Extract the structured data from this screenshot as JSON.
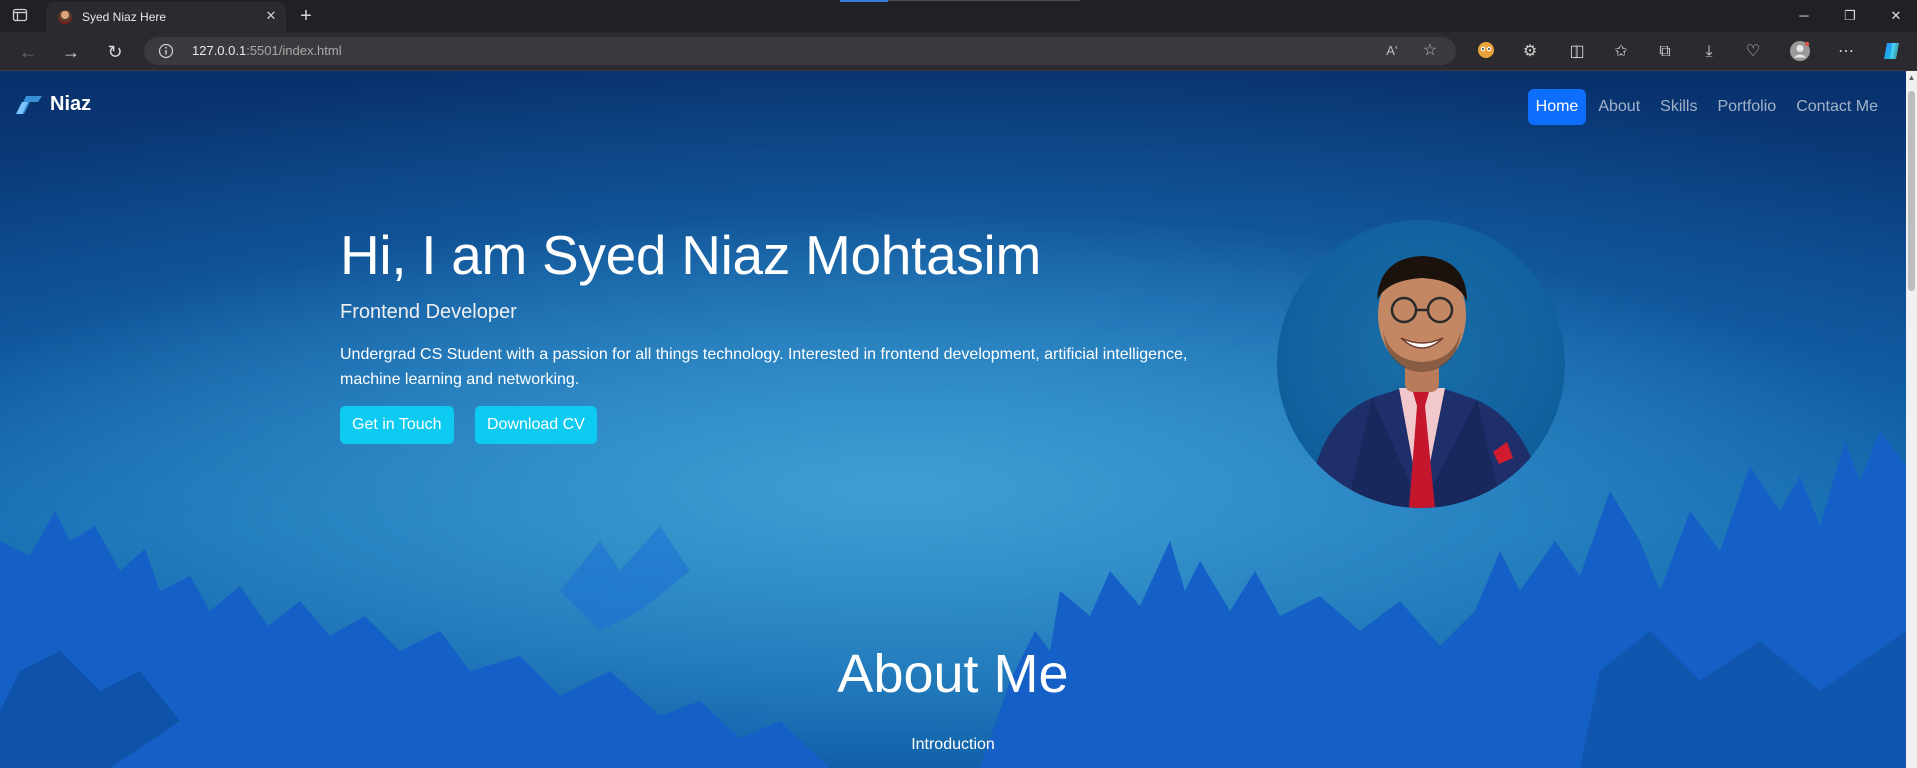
{
  "browser": {
    "tab_title": "Syed Niaz Here",
    "url_host": "127.0.0.1",
    "url_rest": ":5501/index.html",
    "read_aloud_label": "Aʻ"
  },
  "nav": {
    "brand": "Niaz",
    "links": [
      "Home",
      "About",
      "Skills",
      "Portfolio",
      "Contact Me"
    ],
    "active": "Home"
  },
  "hero": {
    "title": "Hi, I am Syed Niaz Mohtasim",
    "subtitle": "Frontend Developer",
    "description": "Undergrad CS Student with a passion for all things technology. Interested in frontend development, artificial intelligence, machine learning and networking.",
    "buttons": [
      "Get in Touch",
      "Download CV"
    ]
  },
  "about": {
    "title": "About Me",
    "subtitle": "Introduction"
  },
  "colors": {
    "accent": "#0d6efd",
    "button": "#0dcaf0",
    "background_top": "#08306b",
    "background_glow": "#3f9fd3"
  },
  "icons": [
    "sidebar-icon",
    "back-icon",
    "forward-icon",
    "refresh-icon",
    "info-icon",
    "star-icon",
    "extensions-icon",
    "split-screen-icon",
    "favorites-icon",
    "collections-icon",
    "download-icon",
    "performance-icon",
    "more-icon",
    "profile-icon",
    "copilot-icon"
  ]
}
